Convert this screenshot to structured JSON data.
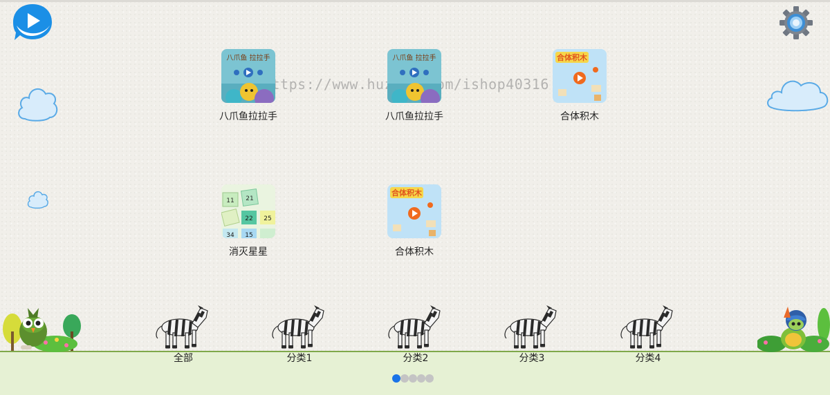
{
  "watermark": "https://www.huzhan.com/ishop40316",
  "colors": {
    "accent": "#1a73e8",
    "ground": "#e6f1d4",
    "ground_line": "#7fa84a",
    "dot_inactive": "#c4c4c4"
  },
  "icons": {
    "logo": "whale-play-logo",
    "settings": "gear-icon"
  },
  "games": [
    {
      "label": "八爪鱼拉拉手",
      "thumb_text": "八爪鱼 拉拉手",
      "thumb": "octopus"
    },
    {
      "label": "八爪鱼拉拉手",
      "thumb_text": "八爪鱼 拉拉手",
      "thumb": "octopus"
    },
    {
      "label": "合体积木",
      "thumb_text": "合体积木",
      "thumb": "blocks"
    },
    {
      "label": "消灭星星",
      "thumb_text": "",
      "thumb": "numbers",
      "cells": [
        "11",
        "21",
        "22",
        "25",
        "34",
        "15"
      ]
    },
    {
      "label": "合体积木",
      "thumb_text": "合体积木",
      "thumb": "blocks"
    }
  ],
  "categories": [
    {
      "label": "全部"
    },
    {
      "label": "分类1"
    },
    {
      "label": "分类2"
    },
    {
      "label": "分类3"
    },
    {
      "label": "分类4"
    }
  ],
  "pager": {
    "total": 5,
    "active": 0
  }
}
